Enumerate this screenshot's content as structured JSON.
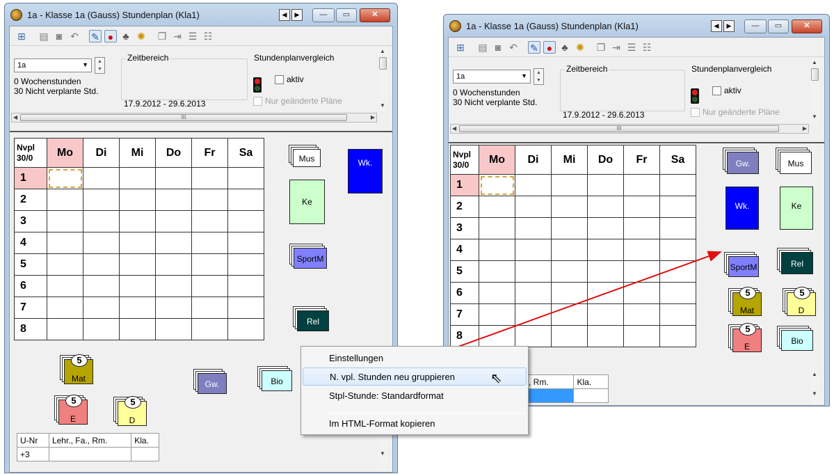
{
  "window_title": "1a - Klasse 1a (Gauss)  Stundenplan  (Kla1)",
  "window_controls": {
    "prev": "◀",
    "next": "▶",
    "minimize": "—",
    "maximize": "▭",
    "close": "✕"
  },
  "toolbar_icons": [
    "grid-plus-icon",
    "copy-icon",
    "lock-icon",
    "undo-icon",
    "edit-icon",
    "pin-icon",
    "people-icon",
    "gear-icon",
    "page-icon",
    "page-arrow-icon",
    "list-icon",
    "teachers-icon"
  ],
  "header": {
    "class_select": "1a",
    "wochenstunden": "0  Wochenstunden",
    "nicht_verplant": "30  Nicht verplante Std.",
    "zeitbereich_label": "Zeitbereich",
    "date_range": "17.9.2012 - 29.6.2013",
    "vergleich_label": "Stundenplanvergleich",
    "aktiv_label": "aktiv",
    "nur_geaenderte_label": "Nur geänderte Pläne"
  },
  "grid": {
    "corner_line1": "Nvpl",
    "corner_line2": "30/0",
    "days": [
      "Mo",
      "Di",
      "Mi",
      "Do",
      "Fr",
      "Sa"
    ],
    "periods": [
      "1",
      "2",
      "3",
      "4",
      "5",
      "6",
      "7",
      "8"
    ]
  },
  "cards": {
    "mus": "Mus",
    "wk": "Wk.",
    "ke": "Ke",
    "sportm": "SportM",
    "rel": "Rel",
    "mat": "Mat",
    "e": "E",
    "d": "D",
    "gw": "Gw.",
    "bio": "Bio",
    "badge_count": "5"
  },
  "bottom_table": {
    "headers": [
      "U-Nr",
      "Lehr., Fa., Rm.",
      "Kla."
    ],
    "row": [
      "+3",
      "",
      ""
    ],
    "right_headers": [
      "a., Rm.",
      "Kla."
    ]
  },
  "scroll_mark": "III",
  "context_menu": {
    "items": [
      "Einstellungen",
      "N. vpl. Stunden neu gruppieren",
      "Stpl-Stunde: Standardformat",
      "Im HTML-Format kopieren"
    ]
  },
  "colors": {
    "mus": "#ffffff",
    "wk": "#0000ff",
    "ke": "#ccffcc",
    "sportm": "#8080ff",
    "rel": "#004040",
    "mat": "#b5a500",
    "e": "#f08080",
    "d": "#ffff99",
    "gw": "#7f7fbf",
    "bio": "#ccffff",
    "arrow": "#e01010"
  }
}
